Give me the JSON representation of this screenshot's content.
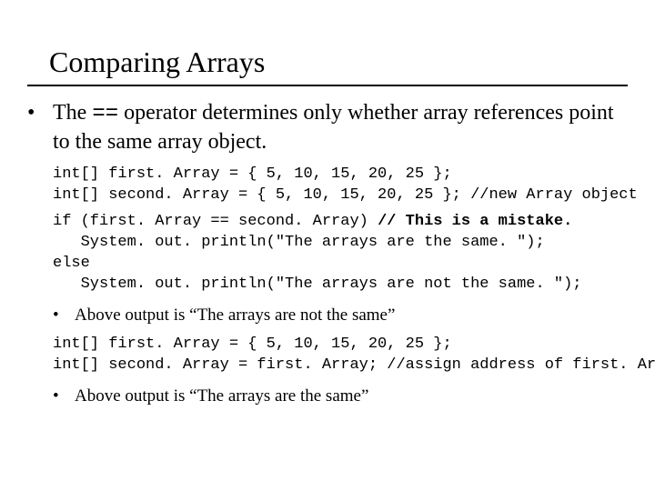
{
  "title": "Comparing Arrays",
  "bullet1_a": "The ",
  "bullet1_op": "==",
  "bullet1_b": " operator determines only whether array references point to the same array object.",
  "code1_line1": "int[] first. Array = { 5, 10, 15, 20, 25 };",
  "code1_line2": "int[] second. Array = { 5, 10, 15, 20, 25 }; //new Array object",
  "code2_line1": "if (first. Array == second. Array) ",
  "code2_line1_bold": "// This is a mistake.",
  "code2_line2": "   System. out. println(\"The arrays are the same. \");",
  "code2_line3": "else",
  "code2_line4": "   System. out. println(\"The arrays are not the same. \");",
  "bullet2": "Above output is “The arrays are not the same”",
  "code3_line1": "int[] first. Array = { 5, 10, 15, 20, 25 };",
  "code3_line2": "int[] second. Array = first. Array; //assign address of first. Array",
  "bullet3": "Above output is “The arrays are the same”"
}
